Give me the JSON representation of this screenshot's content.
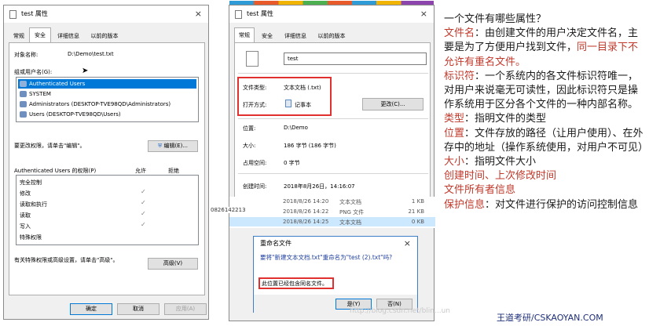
{
  "security_dialog": {
    "title": "test 属性",
    "close": "×",
    "tabs": [
      "常规",
      "安全",
      "详细信息",
      "以前的版本"
    ],
    "object_label": "对象名称:",
    "object_value": "D:\\Demo\\test.txt",
    "group_label": "组或用户名(G):",
    "users": [
      "Authenticated Users",
      "SYSTEM",
      "Administrators (DESKTOP-TVE98QD\\Administrators)",
      "Users (DESKTOP-TVE98QD\\Users)"
    ],
    "edit_hint": "要更改权限，请单击\"编辑\"。",
    "edit_button": "编辑(E)...",
    "perm_header": "Authenticated Users 的权限(P)",
    "allow_header": "允许",
    "deny_header": "拒绝",
    "permissions": [
      "完全控制",
      "修改",
      "读取和执行",
      "读取",
      "写入",
      "特殊权限"
    ],
    "checked_mark": "✓",
    "advanced_hint": "有关特殊权限或高级设置，请单击\"高级\"。",
    "advanced_button": "高级(V)",
    "ok": "确定",
    "cancel": "取消",
    "apply": "应用(A)"
  },
  "general_dialog": {
    "title": "test 属性",
    "close": "×",
    "tabs": [
      "常规",
      "安全",
      "详细信息",
      "以前的版本"
    ],
    "name_value": "test",
    "type_label": "文件类型:",
    "type_value": "文本文档 (.txt)",
    "open_label": "打开方式:",
    "open_value": "记事本",
    "change_button": "更改(C)...",
    "location_label": "位置:",
    "location_value": "D:\\Demo",
    "size_label": "大小:",
    "size_value": "186 字节 (186 字节)",
    "disk_label": "占用空间:",
    "disk_value": "0 字节",
    "created_label": "创建时间:",
    "created_value": "2018年8月26日，14:16:07"
  },
  "file_rows": [
    {
      "date": "2018/8/26 14:20",
      "type": "文本文档",
      "size": "1 KB"
    },
    {
      "date": "2018/8/26 14:22",
      "type": "PNG 文件",
      "size": "21 KB"
    },
    {
      "date": "2018/8/26 14:25",
      "type": "文本文档",
      "size": "0 KB"
    }
  ],
  "left_fragment": "0826142213",
  "rename_dialog": {
    "title": "重命名文件",
    "close": "×",
    "question": "要将\"新建文本文档.txt\"重命名为\"test (2).txt\"吗?",
    "info": "此位置已经包含同名文件。",
    "yes": "是(Y)",
    "no": "否(N)"
  },
  "notes": {
    "heading": "一个文件有哪些属性？",
    "filename_term": "文件名",
    "filename_desc": "：由创建文件的用户决定文件名，主要是为了方便用户找到文件，",
    "filename_rule": "同一目录下不允许有重名文件。",
    "id_term": "标识符",
    "id_desc": "：一个系统内的各文件标识符唯一，对用户来说毫无可读性，因此标识符只是操作系统用于区分各个文件的一种内部名称。",
    "type_term": "类型",
    "type_desc": "：指明文件的类型",
    "location_term": "位置",
    "location_desc": "：文件存放的路径（让用户使用）、在外存中的地址（操作系统使用，对用户不可见）",
    "size_term": "大小",
    "size_desc": "：指明文件大小",
    "time_line": "创建时间、上次修改时间",
    "owner_line": "文件所有者信息",
    "protect_term": "保护信息",
    "protect_desc": "：对文件进行保护的访问控制信息"
  },
  "watermark_blog": "http://blog.csdn.net/blin...un",
  "watermark": "王道考研/CSKAOYAN.COM",
  "colors": {
    "accent_red": "#c0392b",
    "selection": "#0078d7",
    "highlight_box": "#e03030"
  }
}
